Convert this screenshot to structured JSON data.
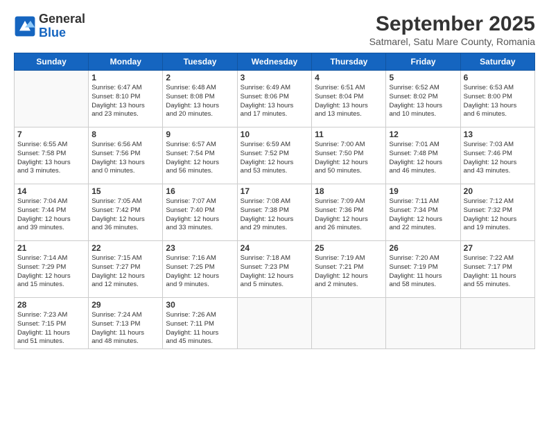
{
  "header": {
    "logo_line1": "General",
    "logo_line2": "Blue",
    "month": "September 2025",
    "location": "Satmarel, Satu Mare County, Romania"
  },
  "days_of_week": [
    "Sunday",
    "Monday",
    "Tuesday",
    "Wednesday",
    "Thursday",
    "Friday",
    "Saturday"
  ],
  "weeks": [
    [
      {
        "day": "",
        "info": ""
      },
      {
        "day": "1",
        "info": "Sunrise: 6:47 AM\nSunset: 8:10 PM\nDaylight: 13 hours\nand 23 minutes."
      },
      {
        "day": "2",
        "info": "Sunrise: 6:48 AM\nSunset: 8:08 PM\nDaylight: 13 hours\nand 20 minutes."
      },
      {
        "day": "3",
        "info": "Sunrise: 6:49 AM\nSunset: 8:06 PM\nDaylight: 13 hours\nand 17 minutes."
      },
      {
        "day": "4",
        "info": "Sunrise: 6:51 AM\nSunset: 8:04 PM\nDaylight: 13 hours\nand 13 minutes."
      },
      {
        "day": "5",
        "info": "Sunrise: 6:52 AM\nSunset: 8:02 PM\nDaylight: 13 hours\nand 10 minutes."
      },
      {
        "day": "6",
        "info": "Sunrise: 6:53 AM\nSunset: 8:00 PM\nDaylight: 13 hours\nand 6 minutes."
      }
    ],
    [
      {
        "day": "7",
        "info": "Sunrise: 6:55 AM\nSunset: 7:58 PM\nDaylight: 13 hours\nand 3 minutes."
      },
      {
        "day": "8",
        "info": "Sunrise: 6:56 AM\nSunset: 7:56 PM\nDaylight: 13 hours\nand 0 minutes."
      },
      {
        "day": "9",
        "info": "Sunrise: 6:57 AM\nSunset: 7:54 PM\nDaylight: 12 hours\nand 56 minutes."
      },
      {
        "day": "10",
        "info": "Sunrise: 6:59 AM\nSunset: 7:52 PM\nDaylight: 12 hours\nand 53 minutes."
      },
      {
        "day": "11",
        "info": "Sunrise: 7:00 AM\nSunset: 7:50 PM\nDaylight: 12 hours\nand 50 minutes."
      },
      {
        "day": "12",
        "info": "Sunrise: 7:01 AM\nSunset: 7:48 PM\nDaylight: 12 hours\nand 46 minutes."
      },
      {
        "day": "13",
        "info": "Sunrise: 7:03 AM\nSunset: 7:46 PM\nDaylight: 12 hours\nand 43 minutes."
      }
    ],
    [
      {
        "day": "14",
        "info": "Sunrise: 7:04 AM\nSunset: 7:44 PM\nDaylight: 12 hours\nand 39 minutes."
      },
      {
        "day": "15",
        "info": "Sunrise: 7:05 AM\nSunset: 7:42 PM\nDaylight: 12 hours\nand 36 minutes."
      },
      {
        "day": "16",
        "info": "Sunrise: 7:07 AM\nSunset: 7:40 PM\nDaylight: 12 hours\nand 33 minutes."
      },
      {
        "day": "17",
        "info": "Sunrise: 7:08 AM\nSunset: 7:38 PM\nDaylight: 12 hours\nand 29 minutes."
      },
      {
        "day": "18",
        "info": "Sunrise: 7:09 AM\nSunset: 7:36 PM\nDaylight: 12 hours\nand 26 minutes."
      },
      {
        "day": "19",
        "info": "Sunrise: 7:11 AM\nSunset: 7:34 PM\nDaylight: 12 hours\nand 22 minutes."
      },
      {
        "day": "20",
        "info": "Sunrise: 7:12 AM\nSunset: 7:32 PM\nDaylight: 12 hours\nand 19 minutes."
      }
    ],
    [
      {
        "day": "21",
        "info": "Sunrise: 7:14 AM\nSunset: 7:29 PM\nDaylight: 12 hours\nand 15 minutes."
      },
      {
        "day": "22",
        "info": "Sunrise: 7:15 AM\nSunset: 7:27 PM\nDaylight: 12 hours\nand 12 minutes."
      },
      {
        "day": "23",
        "info": "Sunrise: 7:16 AM\nSunset: 7:25 PM\nDaylight: 12 hours\nand 9 minutes."
      },
      {
        "day": "24",
        "info": "Sunrise: 7:18 AM\nSunset: 7:23 PM\nDaylight: 12 hours\nand 5 minutes."
      },
      {
        "day": "25",
        "info": "Sunrise: 7:19 AM\nSunset: 7:21 PM\nDaylight: 12 hours\nand 2 minutes."
      },
      {
        "day": "26",
        "info": "Sunrise: 7:20 AM\nSunset: 7:19 PM\nDaylight: 11 hours\nand 58 minutes."
      },
      {
        "day": "27",
        "info": "Sunrise: 7:22 AM\nSunset: 7:17 PM\nDaylight: 11 hours\nand 55 minutes."
      }
    ],
    [
      {
        "day": "28",
        "info": "Sunrise: 7:23 AM\nSunset: 7:15 PM\nDaylight: 11 hours\nand 51 minutes."
      },
      {
        "day": "29",
        "info": "Sunrise: 7:24 AM\nSunset: 7:13 PM\nDaylight: 11 hours\nand 48 minutes."
      },
      {
        "day": "30",
        "info": "Sunrise: 7:26 AM\nSunset: 7:11 PM\nDaylight: 11 hours\nand 45 minutes."
      },
      {
        "day": "",
        "info": ""
      },
      {
        "day": "",
        "info": ""
      },
      {
        "day": "",
        "info": ""
      },
      {
        "day": "",
        "info": ""
      }
    ]
  ]
}
